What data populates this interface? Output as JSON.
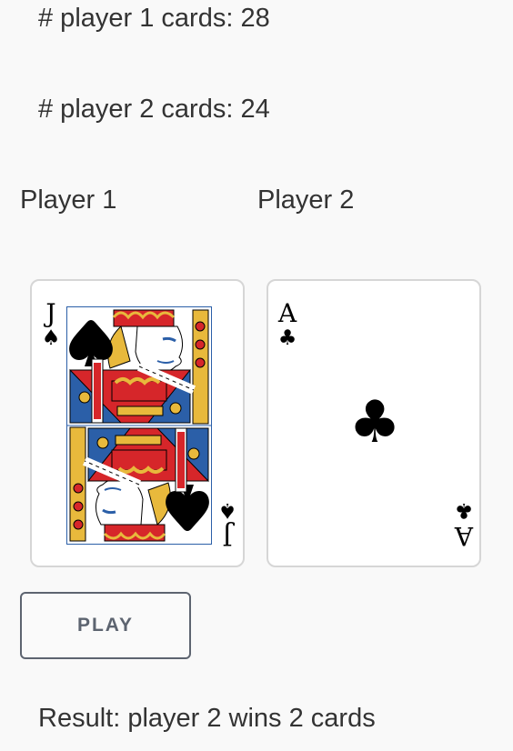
{
  "counts": {
    "player1": "# player 1 cards: 28",
    "player2": "# player 2 cards: 24"
  },
  "players": {
    "p1": "Player 1",
    "p2": "Player 2"
  },
  "cards": {
    "player1": {
      "rank": "J",
      "suit": "♠",
      "suit_name": "spades",
      "face": "jack"
    },
    "player2": {
      "rank": "A",
      "suit": "♣",
      "suit_name": "clubs"
    }
  },
  "controls": {
    "play_label": "PLAY"
  },
  "result": "Result: player 2 wins 2 cards",
  "colors": {
    "background": "#f9f9f9",
    "text": "#333333",
    "button_border": "#5d6470",
    "card_border": "#d6d6d6",
    "jack_red": "#d6262a",
    "jack_blue": "#2b5fa8",
    "jack_gold": "#e8b93c"
  }
}
